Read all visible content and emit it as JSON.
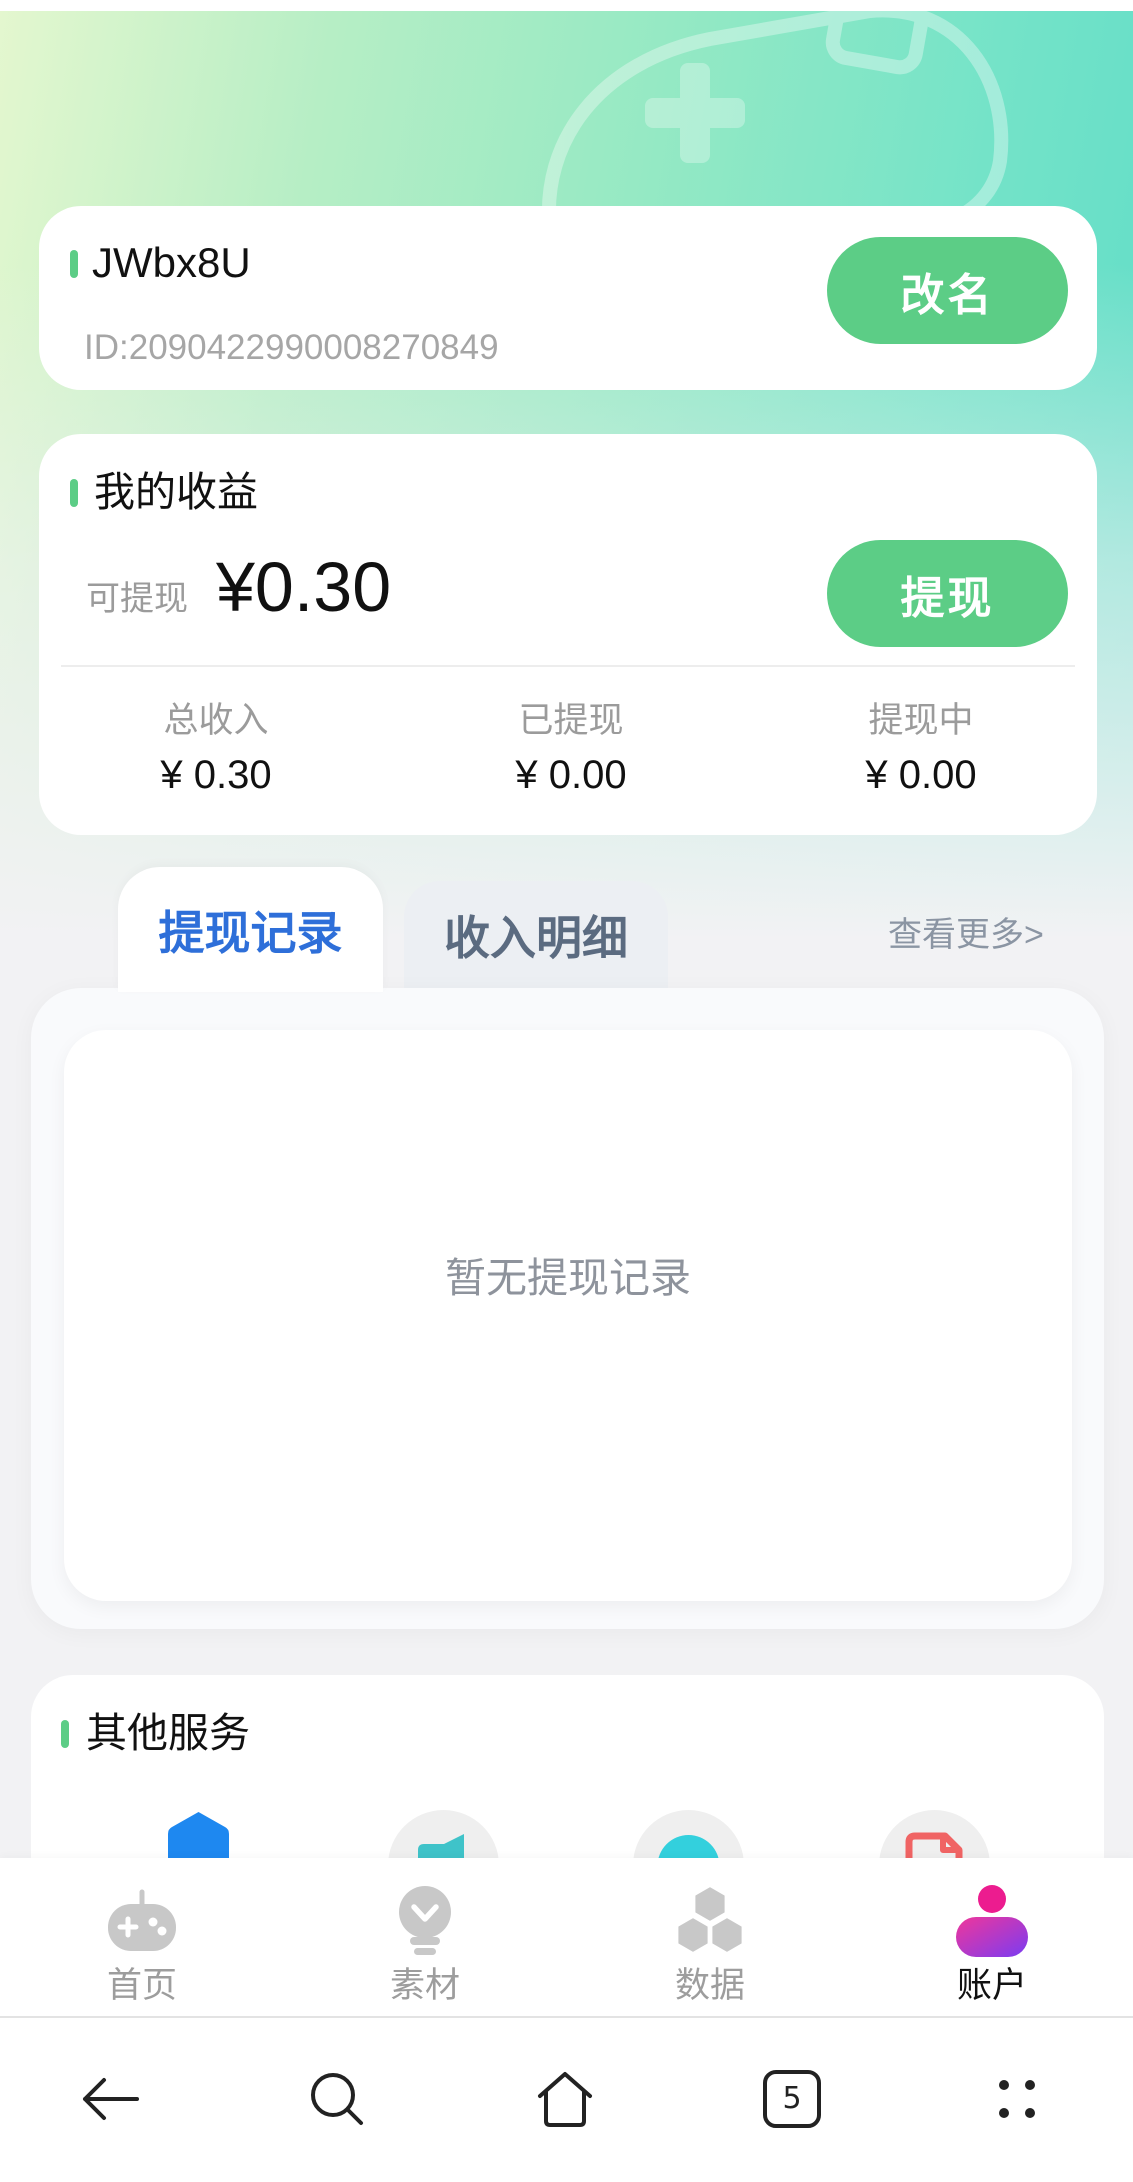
{
  "profile": {
    "name": "JWbx8U",
    "id_text": "ID:2090422990008270849",
    "rename_button": "改名"
  },
  "earnings": {
    "title": "我的收益",
    "withdrawable_label": "可提现",
    "withdrawable_amount": "¥0.30",
    "withdraw_button": "提现",
    "stats": [
      {
        "label": "总收入",
        "value": "¥ 0.30"
      },
      {
        "label": "已提现",
        "value": "¥ 0.00"
      },
      {
        "label": "提现中",
        "value": "¥ 0.00"
      }
    ]
  },
  "records": {
    "tabs": [
      {
        "label": "提现记录",
        "active": true
      },
      {
        "label": "收入明细",
        "active": false
      }
    ],
    "more_link": "查看更多>",
    "empty_text": "暂无提现记录"
  },
  "services": {
    "title": "其他服务",
    "icons": [
      "blue-hexagon-icon",
      "teal-flag-icon",
      "cyan-circle-icon",
      "red-document-icon"
    ]
  },
  "tabbar": {
    "items": [
      {
        "label": "首页",
        "icon": "gamepad-icon",
        "active": false
      },
      {
        "label": "素材",
        "icon": "lightbulb-icon",
        "active": false
      },
      {
        "label": "数据",
        "icon": "hexagons-icon",
        "active": false
      },
      {
        "label": "账户",
        "icon": "account-person-icon",
        "active": true
      }
    ]
  },
  "browser_nav": {
    "icons": [
      "back-arrow-icon",
      "search-icon",
      "home-icon",
      "tabs-icon",
      "menu-dots-icon"
    ],
    "tab_count": "5"
  },
  "colors": {
    "accent_green": "#5ccd86",
    "active_tab_blue": "#2e6fd9",
    "inactive_tab_text": "#5b6b80",
    "page_background": "#f2f2f4",
    "account_icon_pink": "#ec1c8f",
    "account_icon_purple": "#7a3cf2"
  }
}
